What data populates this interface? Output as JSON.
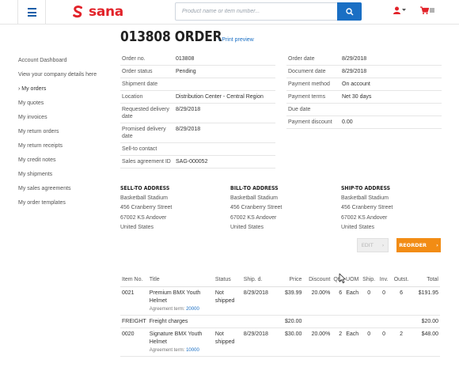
{
  "header": {
    "brand": "sana",
    "search": {
      "placeholder": "Product name or item number..."
    }
  },
  "page": {
    "title": "013808 ORDER",
    "print_link": "› Print preview"
  },
  "sidebar": {
    "items": [
      {
        "label": "Account Dashboard"
      },
      {
        "label": "View your company details here"
      },
      {
        "label": "› My orders"
      },
      {
        "label": "My quotes"
      },
      {
        "label": "My invoices"
      },
      {
        "label": "My return orders"
      },
      {
        "label": "My return receipts"
      },
      {
        "label": "My credit notes"
      },
      {
        "label": "My shipments"
      },
      {
        "label": "My sales agreements"
      },
      {
        "label": "My order templates"
      }
    ]
  },
  "details_left": [
    {
      "key": "Order no.",
      "value": "013808"
    },
    {
      "key": "Order status",
      "value": "Pending"
    },
    {
      "key": "Shipment date",
      "value": ""
    },
    {
      "key": "Location",
      "value": "Distribution Center - Central Region"
    },
    {
      "key": "Requested delivery date",
      "value": "8/29/2018"
    },
    {
      "key": "Promised delivery date",
      "value": "8/29/2018"
    },
    {
      "key": "Sell-to contact",
      "value": ""
    },
    {
      "key": "Sales agreement ID",
      "value": "SAG-000052"
    }
  ],
  "details_right": [
    {
      "key": "Order date",
      "value": "8/29/2018"
    },
    {
      "key": "Document date",
      "value": "8/29/2018"
    },
    {
      "key": "Payment method",
      "value": "On account"
    },
    {
      "key": "Payment terms",
      "value": "Net 30 days"
    },
    {
      "key": "Due date",
      "value": ""
    },
    {
      "key": "Payment discount",
      "value": "0.00"
    }
  ],
  "addresses": [
    {
      "title": "SELL-TO ADDRESS",
      "lines": [
        "Basketball Stadium",
        "456 Cranberry Street",
        "67002 KS Andover",
        "United States"
      ]
    },
    {
      "title": "BILL-TO ADDRESS",
      "lines": [
        "Basketball Stadium",
        "456 Cranberry Street",
        "67002 KS Andover",
        "United States"
      ]
    },
    {
      "title": "SHIP-TO ADDRESS",
      "lines": [
        "Basketball Stadium",
        "456 Cranberry Street",
        "67002 KS Andover",
        "United States"
      ]
    }
  ],
  "actions": {
    "edit": "EDIT",
    "reorder": "REORDER",
    "arrow": "›"
  },
  "lines": {
    "headers": [
      "Item No.",
      "Title",
      "Status",
      "Ship. d.",
      "Price",
      "Discount",
      "Qty",
      "UOM",
      "Ship.",
      "Inv.",
      "Outst.",
      "Total"
    ],
    "rows": [
      {
        "item": "0021",
        "title": "Premium BMX Youth Helmet",
        "agreement_label": "Agreement term:",
        "agreement": "20000",
        "status": "Not shipped",
        "ship": "8/29/2018",
        "price": "$39.99",
        "discount": "20.00%",
        "qty": "6",
        "uom": "Each",
        "shipped": "0",
        "inv": "0",
        "outst": "6",
        "total": "$191.95"
      },
      {
        "item": "FREIGHT",
        "title": "Freight charges",
        "agreement_label": "",
        "agreement": "",
        "status": "",
        "ship": "",
        "price": "$20.00",
        "discount": "",
        "qty": "",
        "uom": "",
        "shipped": "",
        "inv": "",
        "outst": "",
        "total": "$20.00"
      },
      {
        "item": "0020",
        "title": "Signature BMX Youth Helmet",
        "agreement_label": "Agreement term:",
        "agreement": "10000",
        "status": "Not shipped",
        "ship": "8/29/2018",
        "price": "$30.00",
        "discount": "20.00%",
        "qty": "2",
        "uom": "Each",
        "shipped": "0",
        "inv": "0",
        "outst": "2",
        "total": "$48.00"
      }
    ]
  },
  "colors": {
    "brand_red": "#e2232a",
    "accent_blue": "#1a6fc4",
    "reorder_orange": "#f28c14"
  }
}
